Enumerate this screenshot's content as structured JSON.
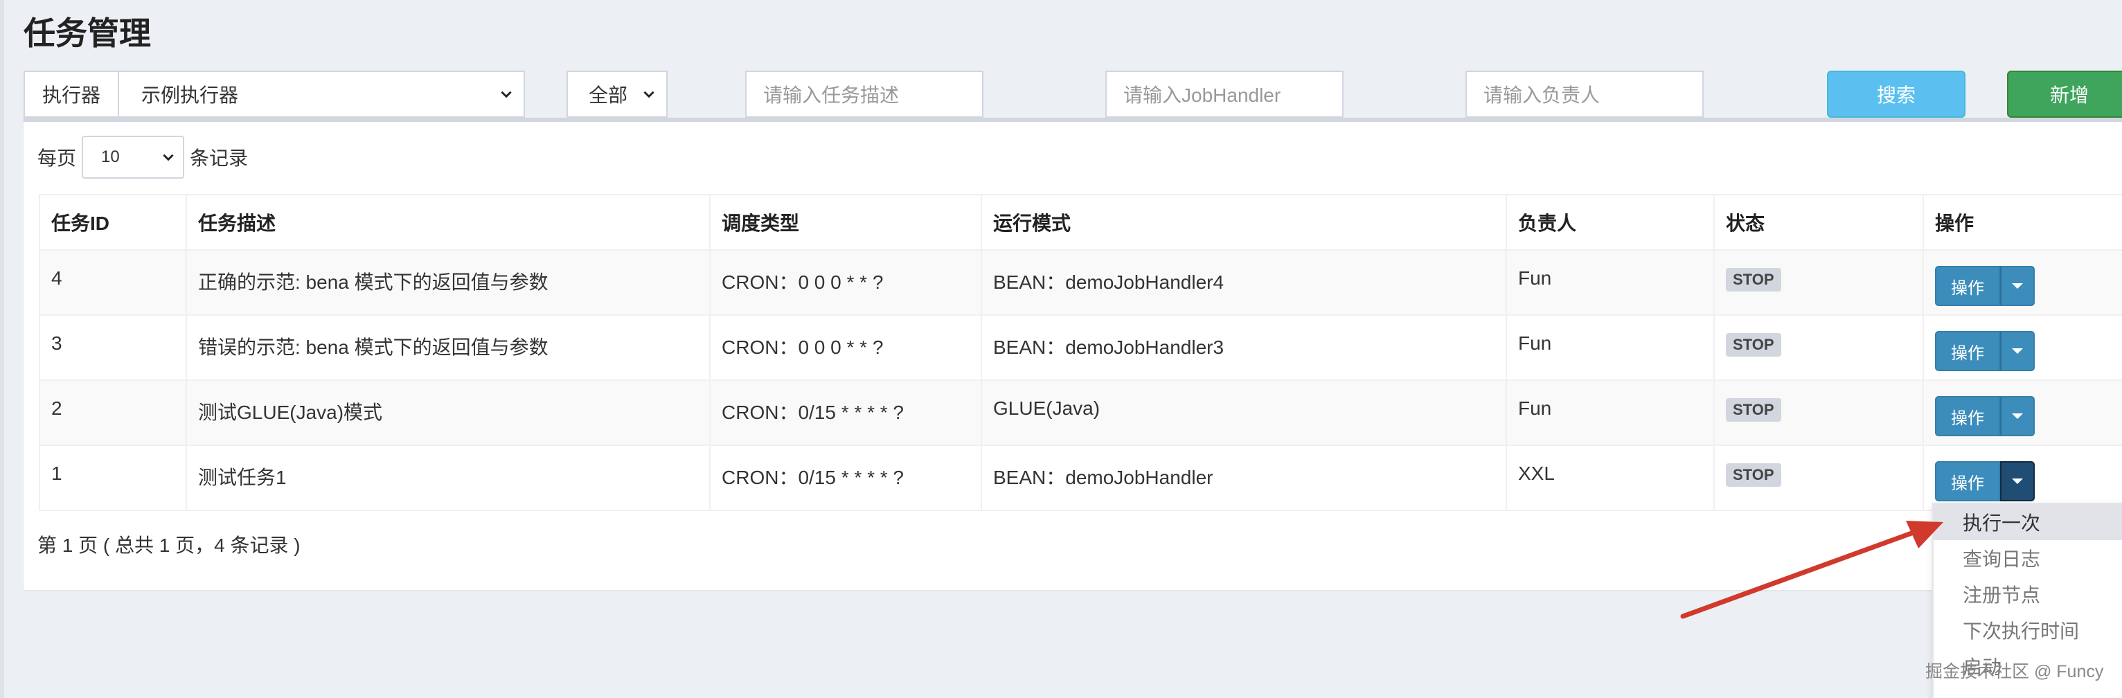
{
  "page": {
    "title": "任务管理"
  },
  "filters": {
    "executor_label": "执行器",
    "executor_value": "示例执行器",
    "status_value": "全部",
    "desc_placeholder": "请输入任务描述",
    "handler_placeholder": "请输入JobHandler",
    "author_placeholder": "请输入负责人",
    "search_label": "搜索",
    "add_label": "新增"
  },
  "paging": {
    "per_page_prefix": "每页",
    "per_page_value": "10",
    "per_page_suffix": "条记录",
    "summary": "第 1 页 ( 总共 1 页，4 条记录 )"
  },
  "table": {
    "headers": [
      "任务ID",
      "任务描述",
      "调度类型",
      "运行模式",
      "负责人",
      "状态",
      "操作"
    ],
    "rows": [
      {
        "id": "4",
        "desc": "正确的示范: bena 模式下的返回值与参数",
        "type": "CRON：0 0 0 * * ?",
        "mode": "BEAN：demoJobHandler4",
        "author": "Fun",
        "status": "STOP",
        "op": "操作"
      },
      {
        "id": "3",
        "desc": "错误的示范: bena 模式下的返回值与参数",
        "type": "CRON：0 0 0 * * ?",
        "mode": "BEAN：demoJobHandler3",
        "author": "Fun",
        "status": "STOP",
        "op": "操作"
      },
      {
        "id": "2",
        "desc": "测试GLUE(Java)模式",
        "type": "CRON：0/15 * * * * ?",
        "mode": "GLUE(Java)",
        "author": "Fun",
        "status": "STOP",
        "op": "操作"
      },
      {
        "id": "1",
        "desc": "测试任务1",
        "type": "CRON：0/15 * * * * ?",
        "mode": "BEAN：demoJobHandler",
        "author": "XXL",
        "status": "STOP",
        "op": "操作"
      }
    ]
  },
  "dropdown": {
    "items": [
      "执行一次",
      "查询日志",
      "注册节点",
      "下次执行时间",
      "启动"
    ]
  },
  "annotation": {
    "arrow_color": "#d0392b"
  },
  "watermark": "掘金技术社区 @ Funcy"
}
